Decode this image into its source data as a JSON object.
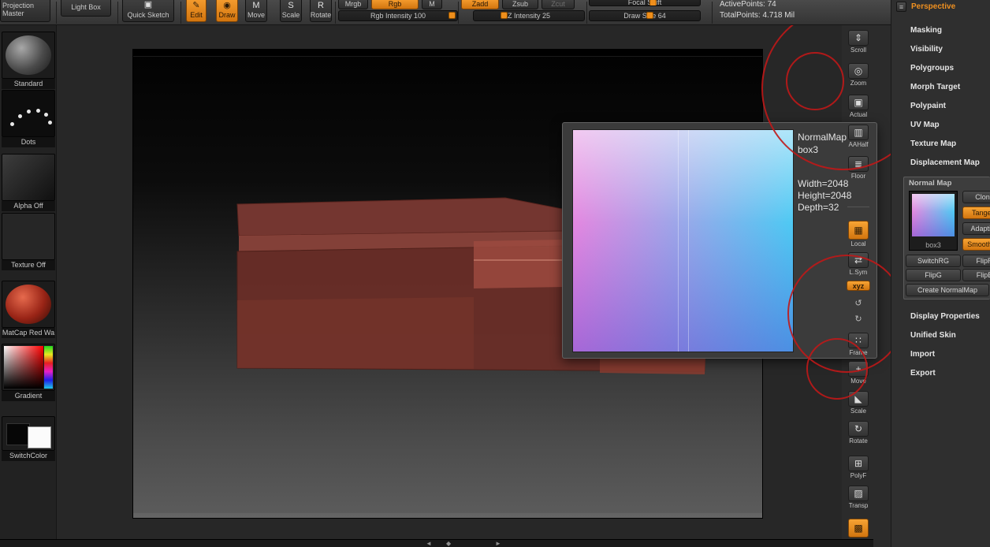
{
  "toolbar": {
    "projection_master": "Projection Master",
    "light_box": "Light Box",
    "quick_sketch": "Quick Sketch",
    "edit": "Edit",
    "draw": "Draw",
    "move": "Move",
    "scale": "Scale",
    "rotate": "Rotate",
    "mrgb": "Mrgb",
    "rgb": "Rgb",
    "m": "M",
    "zadd": "Zadd",
    "zsub": "Zsub",
    "zcut": "Zcut",
    "rgb_intensity": "Rgb Intensity 100",
    "z_intensity": "Z Intensity 25",
    "focal_shift": "Focal Shift",
    "draw_size": "Draw Size 64",
    "active_points": "ActivePoints: 74",
    "total_points": "TotalPoints: 4.718 Mil",
    "icons": {
      "edit": "✎",
      "draw": "◉",
      "quick": "▣",
      "move": "M",
      "scale": "S",
      "rotate": "R",
      "chevron": "▾"
    }
  },
  "left_tray": {
    "items": [
      {
        "label": "Standard"
      },
      {
        "label": "Dots"
      },
      {
        "label": "Alpha Off"
      },
      {
        "label": "Texture Off"
      },
      {
        "label": "MatCap Red Wa"
      },
      {
        "label": "Gradient"
      },
      {
        "label": "SwitchColor"
      }
    ]
  },
  "side_toolbar": {
    "items": [
      {
        "label": "Scroll",
        "icon": "⇕"
      },
      {
        "label": "Zoom",
        "icon": "◎"
      },
      {
        "label": "Actual",
        "icon": "▣"
      },
      {
        "label": "AAHalf",
        "icon": "▥"
      },
      {
        "label": "Floor",
        "icon": "≣"
      },
      {
        "label": "Local",
        "icon": "▦"
      },
      {
        "label": "L.Sym",
        "icon": "⇄"
      },
      {
        "label": "xyz",
        "icon": "xyz"
      },
      {
        "label": "Frame",
        "icon": "∷"
      },
      {
        "label": "Move",
        "icon": "+"
      },
      {
        "label": "Scale",
        "icon": "◣"
      },
      {
        "label": "Rotate",
        "icon": "↻"
      },
      {
        "label": "PolyF",
        "icon": "⊞"
      },
      {
        "label": "Transp",
        "icon": "▨"
      }
    ],
    "extra": {
      "undo": "↺",
      "redo": "↻",
      "ghost": "▩"
    }
  },
  "popup": {
    "line1": "NormalMap",
    "line2": "box3",
    "width": "Width=2048",
    "height": "Height=2048",
    "depth": "Depth=32"
  },
  "right_panel": {
    "perspective": "Perspective",
    "menu_icon": "≡",
    "sections": [
      {
        "label": "Masking"
      },
      {
        "label": "Visibility"
      },
      {
        "label": "Polygroups"
      },
      {
        "label": "Morph Target"
      },
      {
        "label": "Polypaint"
      },
      {
        "label": "UV Map"
      },
      {
        "label": "Texture Map"
      },
      {
        "label": "Displacement Map"
      }
    ],
    "normal_map": {
      "title": "Normal Map",
      "thumb_label": "box3",
      "clone": "Clone",
      "tangent": "Tangent",
      "adaptive": "Adaptive",
      "smoothuv": "SmoothUV",
      "switchrg": "SwitchRG",
      "flipr": "FlipR",
      "flipg": "FlipG",
      "flipb": "FlipB",
      "create": "Create NormalMap"
    },
    "sections_bottom": [
      {
        "label": "Display Properties"
      },
      {
        "label": "Unified Skin"
      },
      {
        "label": "Import"
      },
      {
        "label": "Export"
      }
    ]
  },
  "bottom_bar": {
    "left_arrow": "◄",
    "mid": "◆",
    "right_arrow": "►"
  }
}
